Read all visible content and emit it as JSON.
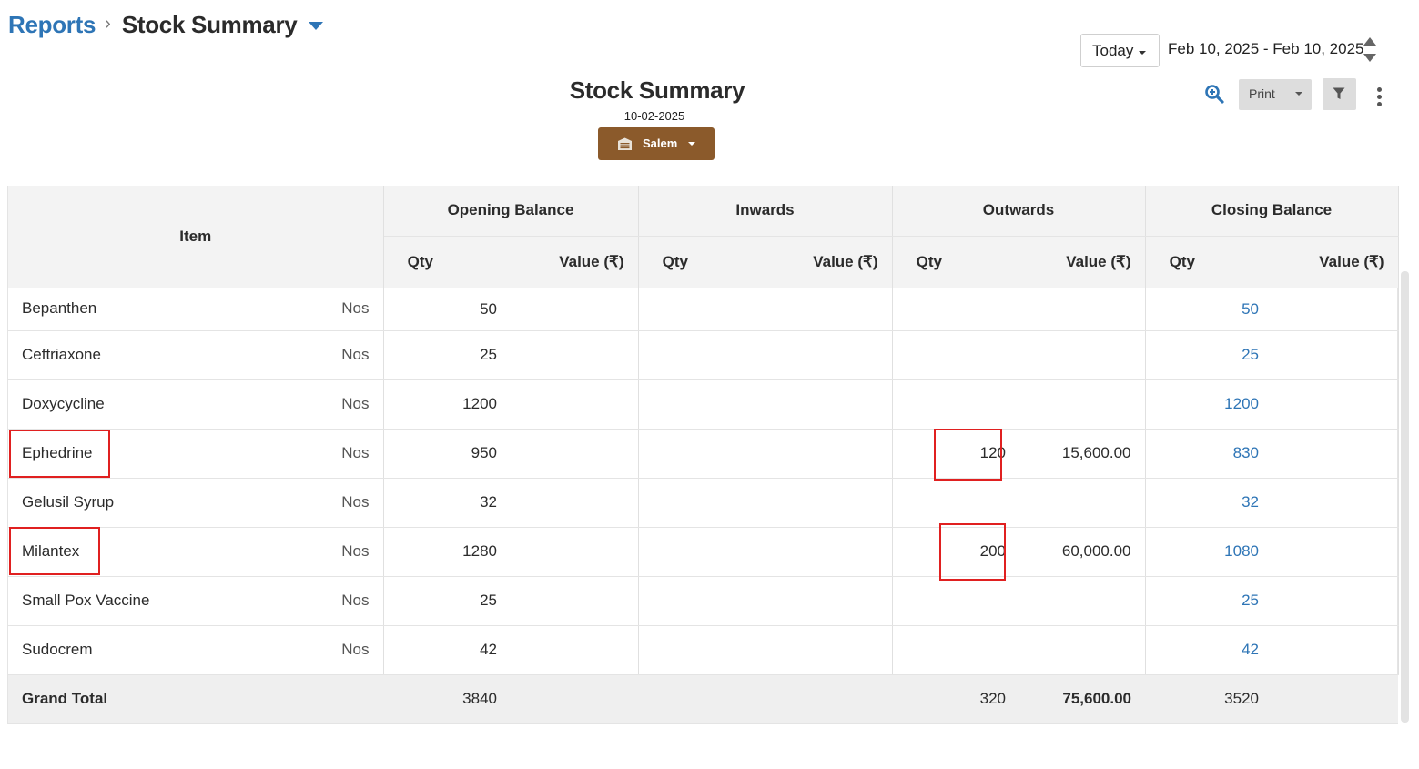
{
  "breadcrumb": {
    "parent": "Reports",
    "separator": "›",
    "current": "Stock Summary"
  },
  "date_controls": {
    "period": "Today",
    "range": "Feb 10, 2025 - Feb 10, 2025"
  },
  "report": {
    "title": "Stock Summary",
    "date": "10-02-2025",
    "branch": "Salem"
  },
  "toolbar": {
    "print_label": "Print"
  },
  "colors": {
    "link": "#2e75b6",
    "branch_button": "#8b5a2b",
    "highlight": "#e02020"
  },
  "table": {
    "item_header": "Item",
    "groups": [
      "Opening Balance",
      "Inwards",
      "Outwards",
      "Closing Balance"
    ],
    "sub_qty": "Qty",
    "sub_value": "Value (₹)",
    "rows": [
      {
        "name": "Bepanthen",
        "unit": "Nos",
        "open_qty": "50",
        "open_val": "",
        "in_qty": "",
        "in_val": "",
        "out_qty": "",
        "out_val": "",
        "close_qty": "50",
        "close_val": ""
      },
      {
        "name": "Ceftriaxone",
        "unit": "Nos",
        "open_qty": "25",
        "open_val": "",
        "in_qty": "",
        "in_val": "",
        "out_qty": "",
        "out_val": "",
        "close_qty": "25",
        "close_val": ""
      },
      {
        "name": "Doxycycline",
        "unit": "Nos",
        "open_qty": "1200",
        "open_val": "",
        "in_qty": "",
        "in_val": "",
        "out_qty": "",
        "out_val": "",
        "close_qty": "1200",
        "close_val": ""
      },
      {
        "name": "Ephedrine",
        "unit": "Nos",
        "open_qty": "950",
        "open_val": "",
        "in_qty": "",
        "in_val": "",
        "out_qty": "120",
        "out_val": "15,600.00",
        "close_qty": "830",
        "close_val": ""
      },
      {
        "name": "Gelusil Syrup",
        "unit": "Nos",
        "open_qty": "32",
        "open_val": "",
        "in_qty": "",
        "in_val": "",
        "out_qty": "",
        "out_val": "",
        "close_qty": "32",
        "close_val": ""
      },
      {
        "name": "Milantex",
        "unit": "Nos",
        "open_qty": "1280",
        "open_val": "",
        "in_qty": "",
        "in_val": "",
        "out_qty": "200",
        "out_val": "60,000.00",
        "close_qty": "1080",
        "close_val": ""
      },
      {
        "name": "Small Pox Vaccine",
        "unit": "Nos",
        "open_qty": "25",
        "open_val": "",
        "in_qty": "",
        "in_val": "",
        "out_qty": "",
        "out_val": "",
        "close_qty": "25",
        "close_val": ""
      },
      {
        "name": "Sudocrem",
        "unit": "Nos",
        "open_qty": "42",
        "open_val": "",
        "in_qty": "",
        "in_val": "",
        "out_qty": "",
        "out_val": "",
        "close_qty": "42",
        "close_val": ""
      }
    ],
    "total": {
      "label": "Grand Total",
      "open_qty": "3840",
      "open_val": "",
      "in_qty": "",
      "in_val": "",
      "out_qty": "320",
      "out_val": "75,600.00",
      "close_qty": "3520",
      "close_val": ""
    }
  }
}
